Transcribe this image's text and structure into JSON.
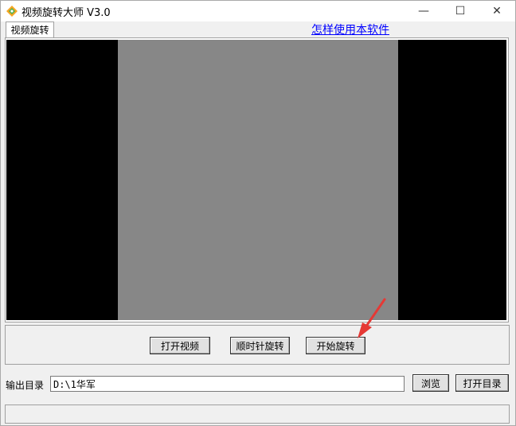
{
  "window": {
    "title": "视频旋转大师 V3.0",
    "icon": "app-logo-icon",
    "controls": {
      "minimize": "—",
      "maximize": "☐",
      "close": "✕"
    }
  },
  "tabs": [
    {
      "label": "视频旋转",
      "active": true
    }
  ],
  "help_link": "怎样使用本软件",
  "video": {
    "background": "#000000",
    "frame_color": "#878787"
  },
  "actions": {
    "open_video": "打开视频",
    "rotate_clockwise": "顺时针旋转",
    "start_rotate": "开始旋转"
  },
  "output": {
    "label": "输出目录",
    "path": "D:\\1华军",
    "browse": "浏览",
    "open_dir": "打开目录"
  },
  "annotation": {
    "color": "#e53935",
    "icon": "red-arrow-pointer"
  }
}
